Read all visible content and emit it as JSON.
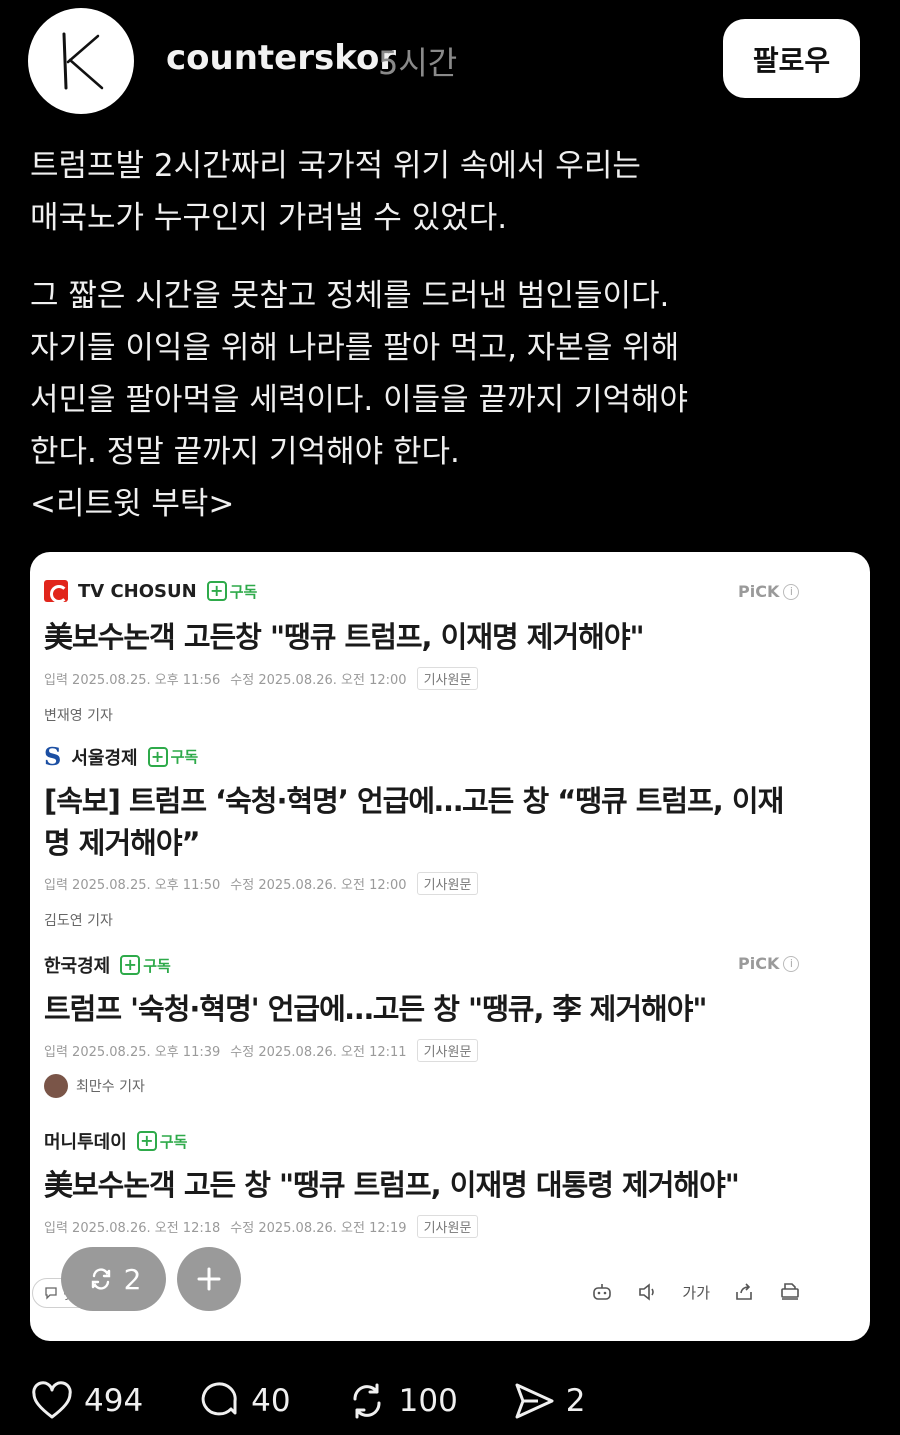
{
  "header": {
    "username": "counterskor",
    "time": "5시간",
    "follow_label": "팔로우"
  },
  "post": {
    "lines": [
      "트럼프발 2시간짜리 국가적 위기 속에서 우리는",
      "매국노가 누구인지 가려낼 수 있었다.",
      "그 짧은 시간을 못참고 정체를 드러낸 범인들이다.",
      "자기들 이익을 위해 나라를 팔아 먹고, 자본을 위해",
      "서민을 팔아먹을 세력이다. 이들을 끝까지 기억해야",
      "한다. 정말 끝까지 기억해야 한다.",
      "<리트윗 부탁>"
    ]
  },
  "card": {
    "subscribe_label": "구독",
    "pick_label": "PiCK",
    "original_label": "기사원문",
    "articles": [
      {
        "publisher": "TV CHOSUN",
        "headline_lines": [
          "美보수논객 고든창 \"땡큐 트럼프, 이재명 제거해야\""
        ],
        "input": "입력 2025.08.25. 오후 11:56",
        "modified": "수정 2025.08.26. 오전 12:00",
        "reporter": "변재영 기자"
      },
      {
        "publisher": "서울경제",
        "headline_lines": [
          "[속보] 트럼프 ‘숙청·혁명’ 언급에…고든 창 “땡큐 트럼프, 이재",
          "명 제거해야”"
        ],
        "input": "입력 2025.08.25. 오후 11:50",
        "modified": "수정 2025.08.26. 오전 12:00",
        "reporter": "김도연 기자"
      },
      {
        "publisher": "한국경제",
        "headline_lines": [
          "트럼프 '숙청·혁명' 언급에…고든 창 \"땡큐, 李 제거해야\""
        ],
        "input": "입력 2025.08.25. 오후 11:39",
        "modified": "수정 2025.08.26. 오전 12:11",
        "reporter": "최만수 기자"
      },
      {
        "publisher": "머니투데이",
        "headline_lines": [
          "美보수논객 고든 창 \"땡큐 트럼프, 이재명 대통령 제거해야\""
        ],
        "input": "입력 2025.08.26. 오전 12:18",
        "modified": "수정 2025.08.26. 오전 12:19"
      }
    ],
    "tools": {
      "font_label": "가가"
    },
    "repost_fab_count": "2",
    "under_fab_label": "댓"
  },
  "actions": {
    "likes": "494",
    "comments": "40",
    "reposts": "100",
    "shares": "2"
  }
}
